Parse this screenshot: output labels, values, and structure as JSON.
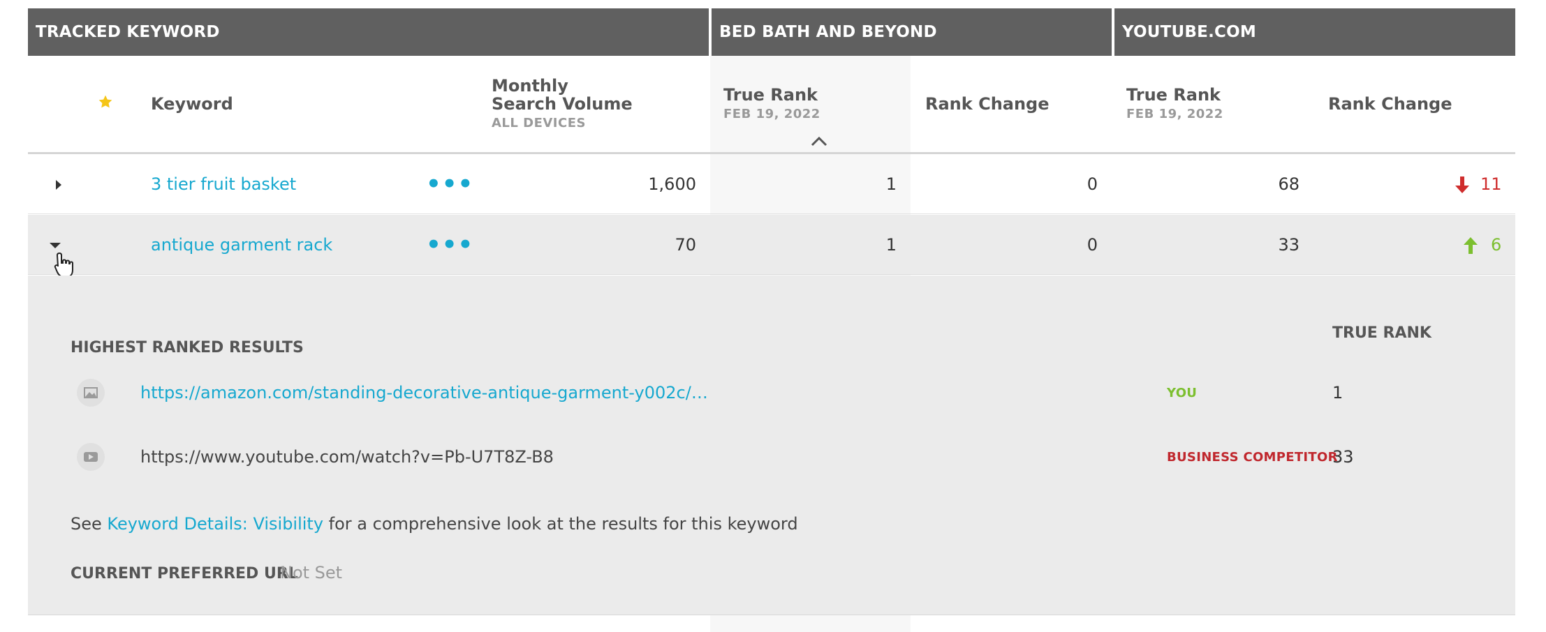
{
  "groups": {
    "tracked": "TRACKED KEYWORD",
    "site1": "BED BATH AND BEYOND",
    "site2": "YOUTUBE.COM"
  },
  "columns": {
    "keyword": "Keyword",
    "volume_line1": "Monthly",
    "volume_line2": "Search Volume",
    "volume_sub": "ALL DEVICES",
    "true_rank": "True Rank",
    "date": "FEB 19, 2022",
    "rank_change": "Rank Change"
  },
  "rows": [
    {
      "keyword": "3 tier fruit basket",
      "more": "•••",
      "volume": "1,600",
      "rank1": "1",
      "change1": "0",
      "rank2": "68",
      "change2": "11",
      "change2_dir": "down"
    },
    {
      "keyword": "antique garment rack",
      "more": "•••",
      "volume": "70",
      "rank1": "1",
      "change1": "0",
      "rank2": "33",
      "change2": "6",
      "change2_dir": "up"
    }
  ],
  "detail": {
    "heading": "HIGHEST RANKED RESULTS",
    "true_rank_header": "TRUE RANK",
    "results": [
      {
        "icon": "image-icon",
        "url": "https://amazon.com/standing-decorative-antique-garment-y002c/…",
        "tag": "YOU",
        "rank": "1"
      },
      {
        "icon": "video-icon",
        "url": "https://www.youtube.com/watch?v=Pb-U7T8Z-B8",
        "tag": "BUSINESS COMPETITOR",
        "rank": "33"
      }
    ],
    "see_prefix": "See ",
    "see_link": "Keyword Details: Visibility",
    "see_suffix": " for a comprehensive look at the results for this keyword",
    "preferred_label": "CURRENT PREFERRED URL",
    "preferred_value": "Not Set"
  },
  "colors": {
    "header_bg": "#606060",
    "link": "#16a8cf",
    "down": "#cf2d2d",
    "up": "#7cbf2f",
    "star": "#f5c518",
    "competitor": "#c0272d"
  }
}
